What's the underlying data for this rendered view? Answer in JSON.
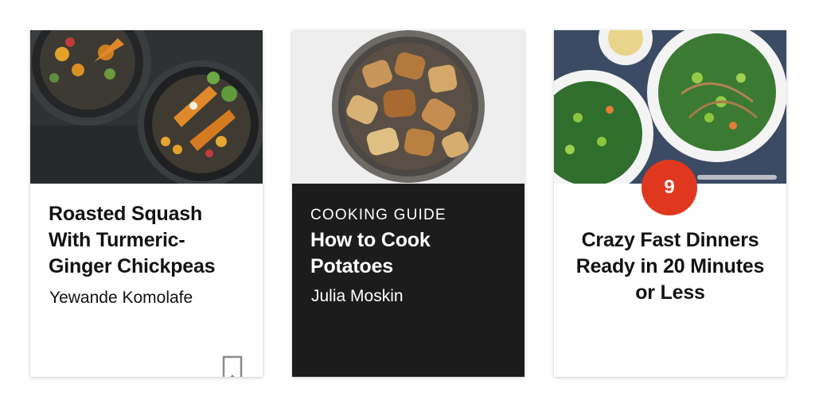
{
  "cards": [
    {
      "title": "Roasted Squash With Turmeric-Ginger Chickpeas",
      "author": "Yewande Komolafe",
      "icon": "bookmark-icon"
    },
    {
      "kicker": "COOKING GUIDE",
      "title": "How to Cook Potatoes",
      "author": "Julia Moskin"
    },
    {
      "count": "9",
      "title": "Crazy Fast Dinners Ready in 20 Minutes or Less"
    }
  ],
  "colors": {
    "badge": "#e0371f",
    "guide_background": "#1c1c1c",
    "text": "#121212"
  }
}
